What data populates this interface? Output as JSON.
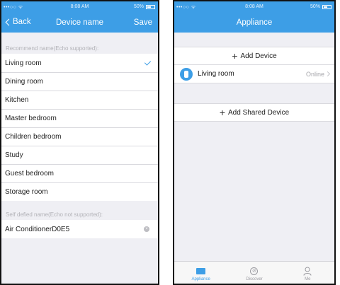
{
  "left": {
    "status": {
      "signal": "•••○○ ᯤ",
      "time": "8:08 AM",
      "battery": "50%"
    },
    "nav": {
      "back": "Back",
      "title": "Device name",
      "save": "Save"
    },
    "recommend_header": "Recommend name(Echo supported):",
    "rooms": [
      {
        "label": "Living room",
        "selected": true
      },
      {
        "label": "Dining room"
      },
      {
        "label": "Kitchen"
      },
      {
        "label": "Master bedroom"
      },
      {
        "label": "Children bedroom"
      },
      {
        "label": "Study"
      },
      {
        "label": "Guest bedroom"
      },
      {
        "label": "Storage room"
      }
    ],
    "custom_header": "Self defied name(Echo not supported):",
    "custom_value": "Air ConditionerD0E5",
    "clear_glyph": "×"
  },
  "right": {
    "status": {
      "signal": "•••○○ ᯤ",
      "time": "8:08 AM",
      "battery": "50%"
    },
    "nav": {
      "title": "Appliance"
    },
    "add_device": {
      "icon": "+",
      "label": "Add Device"
    },
    "device": {
      "name": "Living room",
      "status": "Online"
    },
    "add_shared": {
      "icon": "+",
      "label": "Add Shared Device"
    },
    "tabs": [
      {
        "label": "Appliance",
        "icon": "appliance-icon",
        "active": true
      },
      {
        "label": "Discover",
        "icon": "compass-icon",
        "active": false
      },
      {
        "label": "Me",
        "icon": "person-icon",
        "active": false
      }
    ],
    "compass_glyph": "⊘",
    "accent_color": "#3d9ee6"
  }
}
